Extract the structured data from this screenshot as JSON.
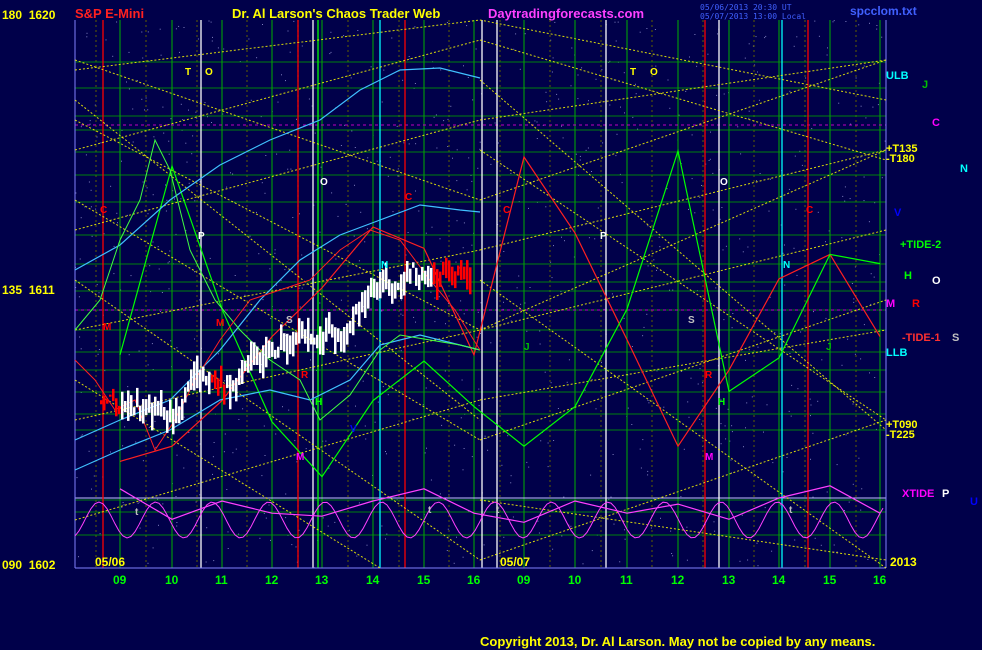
{
  "header": {
    "instrument": "S&P E-Mini",
    "title": "Dr. Al Larson's Chaos Trader Web",
    "website": "Daytradingforecasts.com",
    "timestamp_1": "05/06/2013 20:30 UT",
    "timestamp_2": "05/07/2013 13:00 Local",
    "file": "spcclom.txt",
    "copyright": "Copyright 2013, Dr. Al Larson. May not be copied by any means."
  },
  "left_axis": {
    "top": "180  1620",
    "mid": "135  1611",
    "bottom": "090  1602"
  },
  "x_axis": {
    "date_start": "05/06",
    "date_mid": "05/07",
    "year": "2013",
    "hours_day1": [
      "09",
      "10",
      "11",
      "12",
      "13",
      "14",
      "15",
      "16"
    ],
    "hours_day2": [
      "09",
      "10",
      "11",
      "12",
      "13",
      "14",
      "15",
      "16"
    ]
  },
  "right_labels": [
    {
      "text": "ULB",
      "color": "#00ffff"
    },
    {
      "text": "J",
      "color": "#00c000"
    },
    {
      "text": "C",
      "color": "#ff00ff"
    },
    {
      "text": "+T135",
      "color": "#ffff00"
    },
    {
      "text": "-T180",
      "color": "#ffff00"
    },
    {
      "text": "N",
      "color": "#00ffff"
    },
    {
      "text": "V",
      "color": "#0000ff"
    },
    {
      "text": "+TIDE-2",
      "color": "#00ff00"
    },
    {
      "text": "H",
      "color": "#00ff00"
    },
    {
      "text": "O",
      "color": "#ffffff"
    },
    {
      "text": "M",
      "color": "#ff00ff"
    },
    {
      "text": "R",
      "color": "#ff0000"
    },
    {
      "text": "-TIDE-1",
      "color": "#ff3030"
    },
    {
      "text": "S",
      "color": "#c0c0c0"
    },
    {
      "text": "LLB",
      "color": "#00ffff"
    },
    {
      "text": "+T090",
      "color": "#ffff00"
    },
    {
      "text": "-T225",
      "color": "#ffff00"
    },
    {
      "text": "XTIDE",
      "color": "#ff00ff"
    },
    {
      "text": "P",
      "color": "#ffffff"
    },
    {
      "text": "U",
      "color": "#0000ff"
    }
  ],
  "plot_labels": [
    {
      "text": "T",
      "color": "#ffff00"
    },
    {
      "text": "O",
      "color": "#ffff00"
    },
    {
      "text": "T",
      "color": "#ffff00"
    },
    {
      "text": "O",
      "color": "#ffff00"
    },
    {
      "text": "C",
      "color": "#ff0000"
    },
    {
      "text": "C",
      "color": "#ff0000"
    },
    {
      "text": "C",
      "color": "#ff0000"
    },
    {
      "text": "C",
      "color": "#ff0000"
    },
    {
      "text": "P",
      "color": "#ffffff"
    },
    {
      "text": "P",
      "color": "#ffffff"
    },
    {
      "text": "O",
      "color": "#ffffff"
    },
    {
      "text": "O",
      "color": "#ffffff"
    },
    {
      "text": "N",
      "color": "#00ffff"
    },
    {
      "text": "N",
      "color": "#00ffff"
    },
    {
      "text": "S",
      "color": "#c0c0c0"
    },
    {
      "text": "S",
      "color": "#c0c0c0"
    },
    {
      "text": "R",
      "color": "#ff0000"
    },
    {
      "text": "R",
      "color": "#ff0000"
    },
    {
      "text": "H",
      "color": "#00ff00"
    },
    {
      "text": "H",
      "color": "#00ff00"
    },
    {
      "text": "V",
      "color": "#0000ff"
    },
    {
      "text": "M",
      "color": "#ff00ff"
    },
    {
      "text": "M",
      "color": "#ff00ff"
    },
    {
      "text": "J",
      "color": "#00c000"
    },
    {
      "text": "J",
      "color": "#00c000"
    },
    {
      "text": "M",
      "color": "#ff0000"
    },
    {
      "text": "M",
      "color": "#ff0000"
    },
    {
      "text": "t",
      "color": "#c0c0c0"
    },
    {
      "text": "t",
      "color": "#c0c0c0"
    },
    {
      "text": "t",
      "color": "#c0c0c0"
    },
    {
      "text": "t",
      "color": "#c0c0c0"
    }
  ],
  "colors": {
    "background": "#00004a",
    "grid_hour": "#00b000",
    "grid_h": "#00a000",
    "price_bar": "#ffffff",
    "forecast_bar": "#ff0000",
    "cyan_band": "#40c0ff",
    "green_tide": "#00ff00",
    "red_tide": "#ff2020",
    "xtide": "#ff40ff",
    "fan": "#ffff00"
  },
  "chart_data": {
    "type": "candlestick",
    "title": "S&P E-Mini",
    "y_left_angle": {
      "top": 180,
      "mid": 135,
      "bottom": 90
    },
    "ylim": [
      1602,
      1620
    ],
    "y_mid": 1611,
    "x_categories": [
      "05/06 09",
      "10",
      "11",
      "12",
      "13",
      "14",
      "15",
      "16",
      "05/07 09",
      "10",
      "11",
      "12",
      "13",
      "14",
      "15",
      "16"
    ],
    "price_session_1": {
      "approx_open": 1607.5,
      "approx_low": 1606.4,
      "approx_high": 1614.3,
      "approx_close": 1613.0
    },
    "series": [
      {
        "name": "XTIDE",
        "values": [
          1604.6,
          1603.6,
          1604.2,
          1603.8,
          1603.7,
          1604.2,
          1604.6,
          1603.8,
          1603.5,
          1604.2,
          1603.8,
          1604.1,
          1603.6,
          1604.3,
          1604.7,
          1603.8
        ]
      },
      {
        "name": "TIDE-1",
        "values": [
          1605.5,
          1606.0,
          1607.5,
          1609.6,
          1611.2,
          1613.2,
          1612.5,
          1609.0,
          1615.5,
          1613.0,
          1609.5,
          1606.0,
          1608.5,
          1611.5,
          1612.3,
          1609.6
        ]
      },
      {
        "name": "TIDE-2",
        "values": [
          1609.0,
          1615.2,
          1610.5,
          1606.8,
          1605.0,
          1607.5,
          1608.8,
          1607.3,
          1606.0,
          1607.3,
          1610.5,
          1615.7,
          1607.8,
          1608.9,
          1612.3,
          1612.0
        ]
      }
    ]
  }
}
